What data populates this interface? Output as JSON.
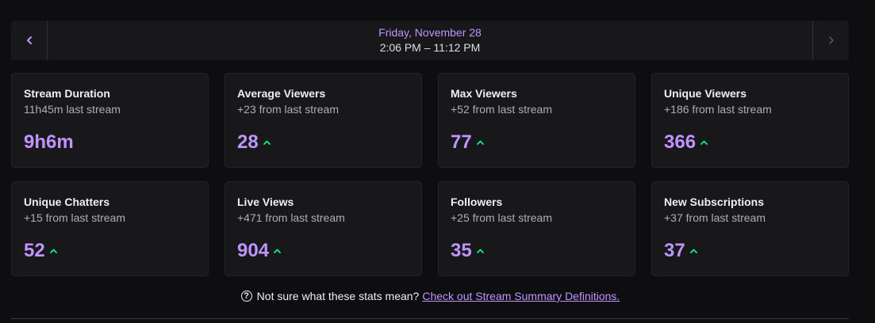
{
  "header": {
    "date": "Friday, November 28",
    "time_range": "2:06 PM – 11:12 PM"
  },
  "colors": {
    "accent": "#bf94ff",
    "trend_up": "#00f593",
    "card_bg": "#18181b",
    "page_bg": "#0e0e10"
  },
  "stats": [
    {
      "title": "Stream Duration",
      "subtitle": "11h45m last stream",
      "value": "9h6m",
      "trend": "none"
    },
    {
      "title": "Average Viewers",
      "subtitle": "+23 from last stream",
      "value": "28",
      "trend": "up"
    },
    {
      "title": "Max Viewers",
      "subtitle": "+52 from last stream",
      "value": "77",
      "trend": "up"
    },
    {
      "title": "Unique Viewers",
      "subtitle": "+186 from last stream",
      "value": "366",
      "trend": "up"
    },
    {
      "title": "Unique Chatters",
      "subtitle": "+15 from last stream",
      "value": "52",
      "trend": "up"
    },
    {
      "title": "Live Views",
      "subtitle": "+471 from last stream",
      "value": "904",
      "trend": "up"
    },
    {
      "title": "Followers",
      "subtitle": "+25 from last stream",
      "value": "35",
      "trend": "up"
    },
    {
      "title": "New Subscriptions",
      "subtitle": "+37 from last stream",
      "value": "37",
      "trend": "up"
    }
  ],
  "help": {
    "icon": "question-circle-icon",
    "glyph": "?",
    "text": "Not sure what these stats mean?",
    "link_text": "Check out Stream Summary Definitions."
  }
}
